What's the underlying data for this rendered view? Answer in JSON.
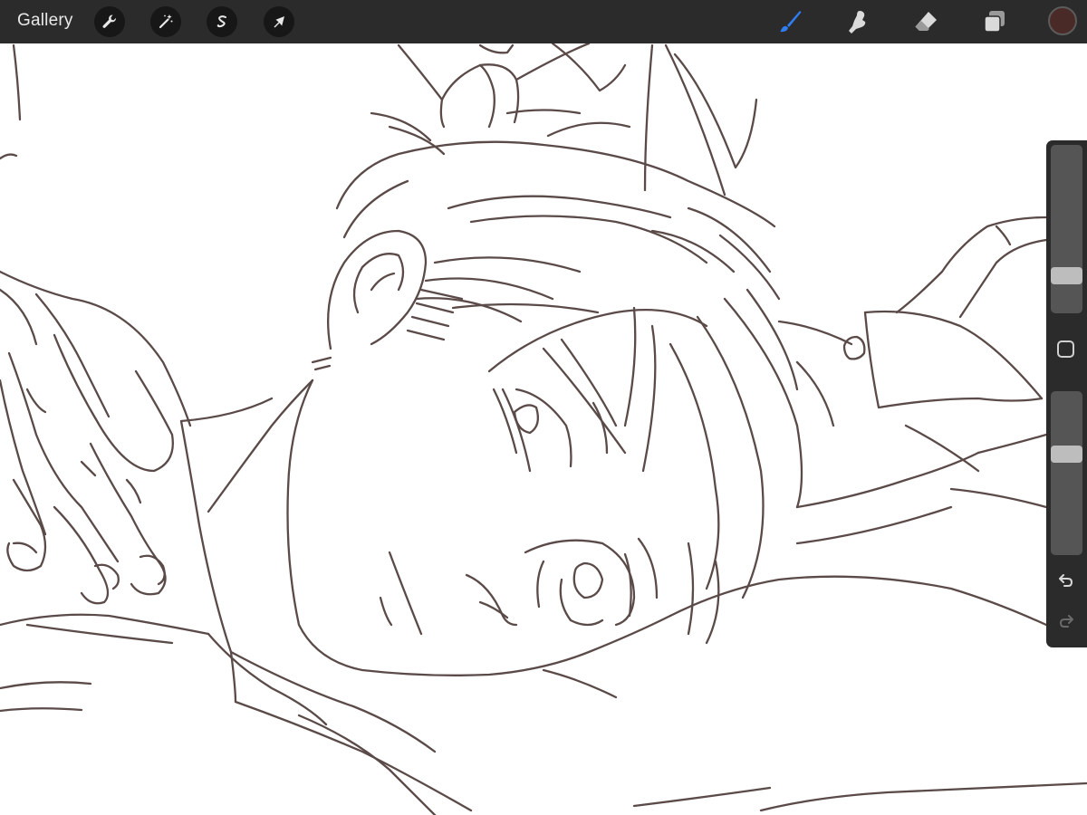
{
  "toolbar": {
    "gallery_label": "Gallery",
    "left_tools": [
      {
        "name": "actions",
        "icon": "wrench-icon"
      },
      {
        "name": "adjustments",
        "icon": "magic-wand-icon"
      },
      {
        "name": "selection",
        "icon": "selection-s-icon"
      },
      {
        "name": "transform",
        "icon": "arrow-cursor-icon"
      }
    ],
    "right_tools": [
      {
        "name": "brush",
        "icon": "brush-icon",
        "active": true
      },
      {
        "name": "smudge",
        "icon": "smudge-finger-icon",
        "active": false
      },
      {
        "name": "eraser",
        "icon": "eraser-icon",
        "active": false
      },
      {
        "name": "layers",
        "icon": "layers-icon",
        "active": false
      }
    ],
    "current_color": "#4a2a26",
    "active_tool_color": "#2f7ef2"
  },
  "sidebar": {
    "brush_size_level": 0.19,
    "opacity_level": 0.63,
    "modify_icon": "square-icon",
    "undo_icon": "undo-icon",
    "redo_icon": "redo-icon"
  },
  "canvas": {
    "line_color": "#5a4a48",
    "background": "#ffffff"
  }
}
